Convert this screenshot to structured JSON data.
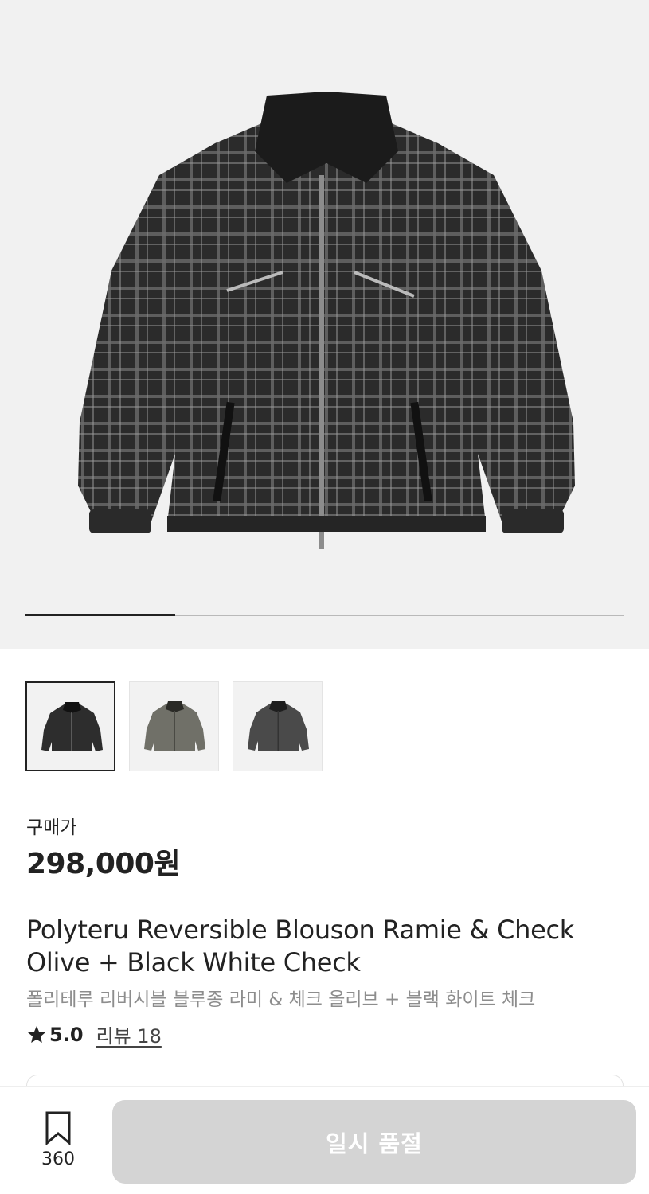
{
  "gallery": {
    "current_index": 1,
    "total": 4,
    "progress_fraction": 0.25,
    "jacket_colors": [
      "#2a2a2a",
      "#4d4c4c",
      "#8a8a8a"
    ]
  },
  "thumbnails": [
    {
      "name": "black-white-check",
      "color": "#2d2d2d",
      "selected": true
    },
    {
      "name": "olive",
      "color": "#707068",
      "selected": false
    },
    {
      "name": "charcoal",
      "color": "#4a4a4a",
      "selected": false
    }
  ],
  "price": {
    "label": "구매가",
    "value": "298,000원"
  },
  "product": {
    "name_en": "Polyteru Reversible Blouson Ramie & Check Olive + Black White Check",
    "name_ko": "폴리테루 리버시블 블루종 라미 & 체크 올리브 + 블랙 화이트 체크"
  },
  "rating": {
    "icon": "star-icon",
    "value": "5.0",
    "review_link": "리뷰 18"
  },
  "bottom_bar": {
    "wish_icon": "bookmark-icon",
    "wish_count": "360",
    "cta_label": "일시 품절",
    "cta_color": "#d4d4d4"
  }
}
